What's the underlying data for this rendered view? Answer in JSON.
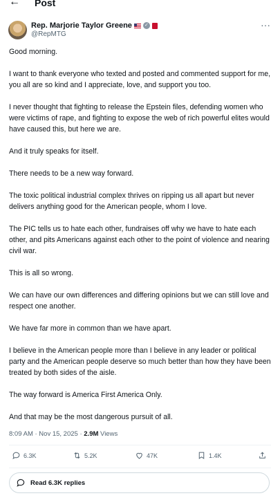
{
  "header": {
    "back_glyph": "←",
    "title": "Post"
  },
  "author": {
    "name": "Rep. Marjorie Taylor Greene",
    "handle": "@RepMTG",
    "more_glyph": "···",
    "flag_icon": "us-flag-icon",
    "verified_icon": "verified-badge-icon",
    "affiliation_icon": "government-badge-icon"
  },
  "post": {
    "paragraphs": [
      "Good morning.",
      "I want to thank everyone who texted and posted and commented support for me, you all are so kind and I appreciate, love, and support you too.",
      "I never thought that fighting to release the Epstein files, defending women who were victims of rape, and fighting to expose the web of rich powerful elites would have caused this, but here we are.",
      "And it truly speaks for itself.",
      "There needs to be a new way forward.",
      "The toxic political industrial complex thrives on ripping us all apart but never delivers anything good for the American people, whom I love.",
      "The PIC tells us to hate each other, fundraises off why we have to hate each other, and pits Americans against each other to the point of violence and nearing civil war.",
      "This is all so wrong.",
      "We can have our own differences and differing opinions but we can still love and respect one another.",
      "We have far more in common than we have apart.",
      "I believe in the American people more than I believe in any leader or political party and the American people deserve so much better than how they have been treated by both sides of the aisle.",
      "The way forward is America First America Only.",
      "And that may be the most dangerous pursuit of all."
    ],
    "timestamp": "8:09 AM · Nov 15, 2025 · ",
    "views_count": "2.9M",
    "views_label": " Views"
  },
  "actions": {
    "replies": "6.3K",
    "reposts": "5.2K",
    "likes": "47K",
    "bookmarks": "1.4K"
  },
  "read_replies": {
    "label": "Read 6.3K replies"
  }
}
